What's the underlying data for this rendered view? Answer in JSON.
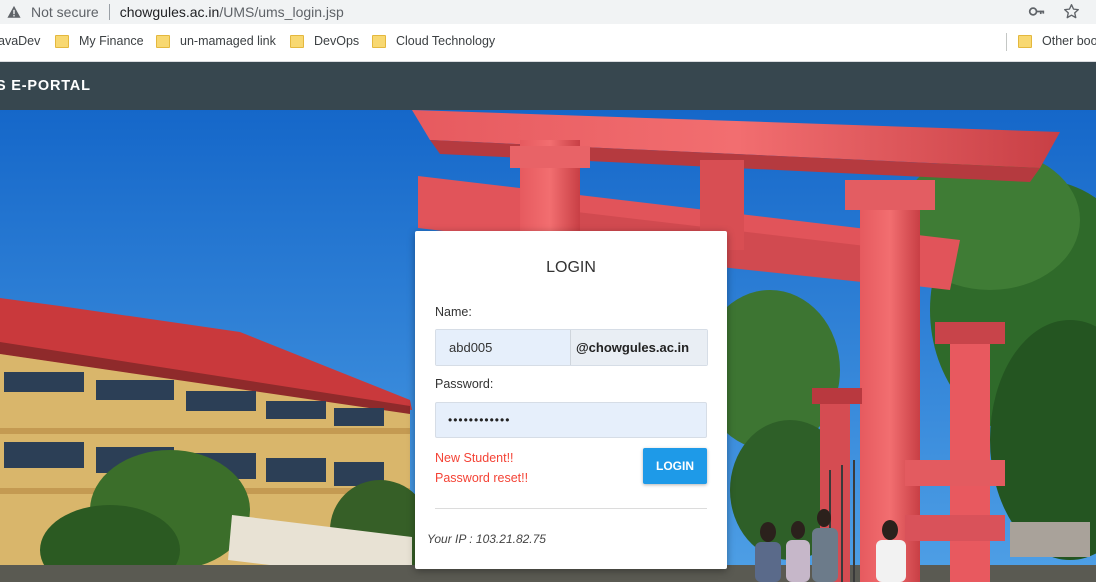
{
  "browser": {
    "security_label": "Not secure",
    "url_domain": "chowgules.ac.in",
    "url_path": "/UMS/ums_login.jsp",
    "icons": [
      "warning-icon",
      "key-icon",
      "star-icon"
    ]
  },
  "bookmarks": {
    "items": [
      {
        "label": "avaDev",
        "icon": "none"
      },
      {
        "label": "My Finance",
        "icon": "folder-icon"
      },
      {
        "label": "un-mamaged link",
        "icon": "folder-icon"
      },
      {
        "label": "DevOps",
        "icon": "folder-icon"
      },
      {
        "label": "Cloud Technology",
        "icon": "folder-icon"
      }
    ],
    "other_label": "Other book"
  },
  "portal": {
    "title": "S E-PORTAL",
    "header_color": "#37474f"
  },
  "login": {
    "title": "LOGIN",
    "name_label": "Name:",
    "name_value": "abd005",
    "domain_suffix": "@chowgules.ac.in",
    "password_label": "Password:",
    "password_mask": "••••••••••••",
    "new_student_link": "New Student!!",
    "password_reset_link": "Password reset!!",
    "login_button": "LOGIN",
    "ip_text": "Your IP : 103.21.82.75",
    "accent_color": "#1e9ae8",
    "link_color": "#f44336"
  }
}
